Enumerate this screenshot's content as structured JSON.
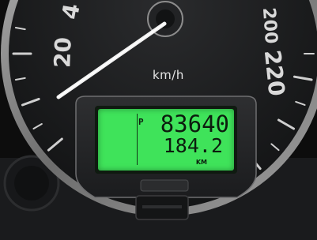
{
  "gauge": {
    "scale_labels": [
      "20",
      "4",
      "200",
      "220"
    ],
    "unit": "km/h",
    "needle_reading_kmh": 10
  },
  "display": {
    "mode": "P",
    "odometer": "83640",
    "trip": "184.2",
    "trip_unit": "KM"
  },
  "colors": {
    "lcd_background": "#3fe35a",
    "lcd_digits": "#0c1c0e",
    "needle": "#f2f2f2",
    "dial_face": "#191a1b",
    "bezel": "#8c8c8c"
  }
}
